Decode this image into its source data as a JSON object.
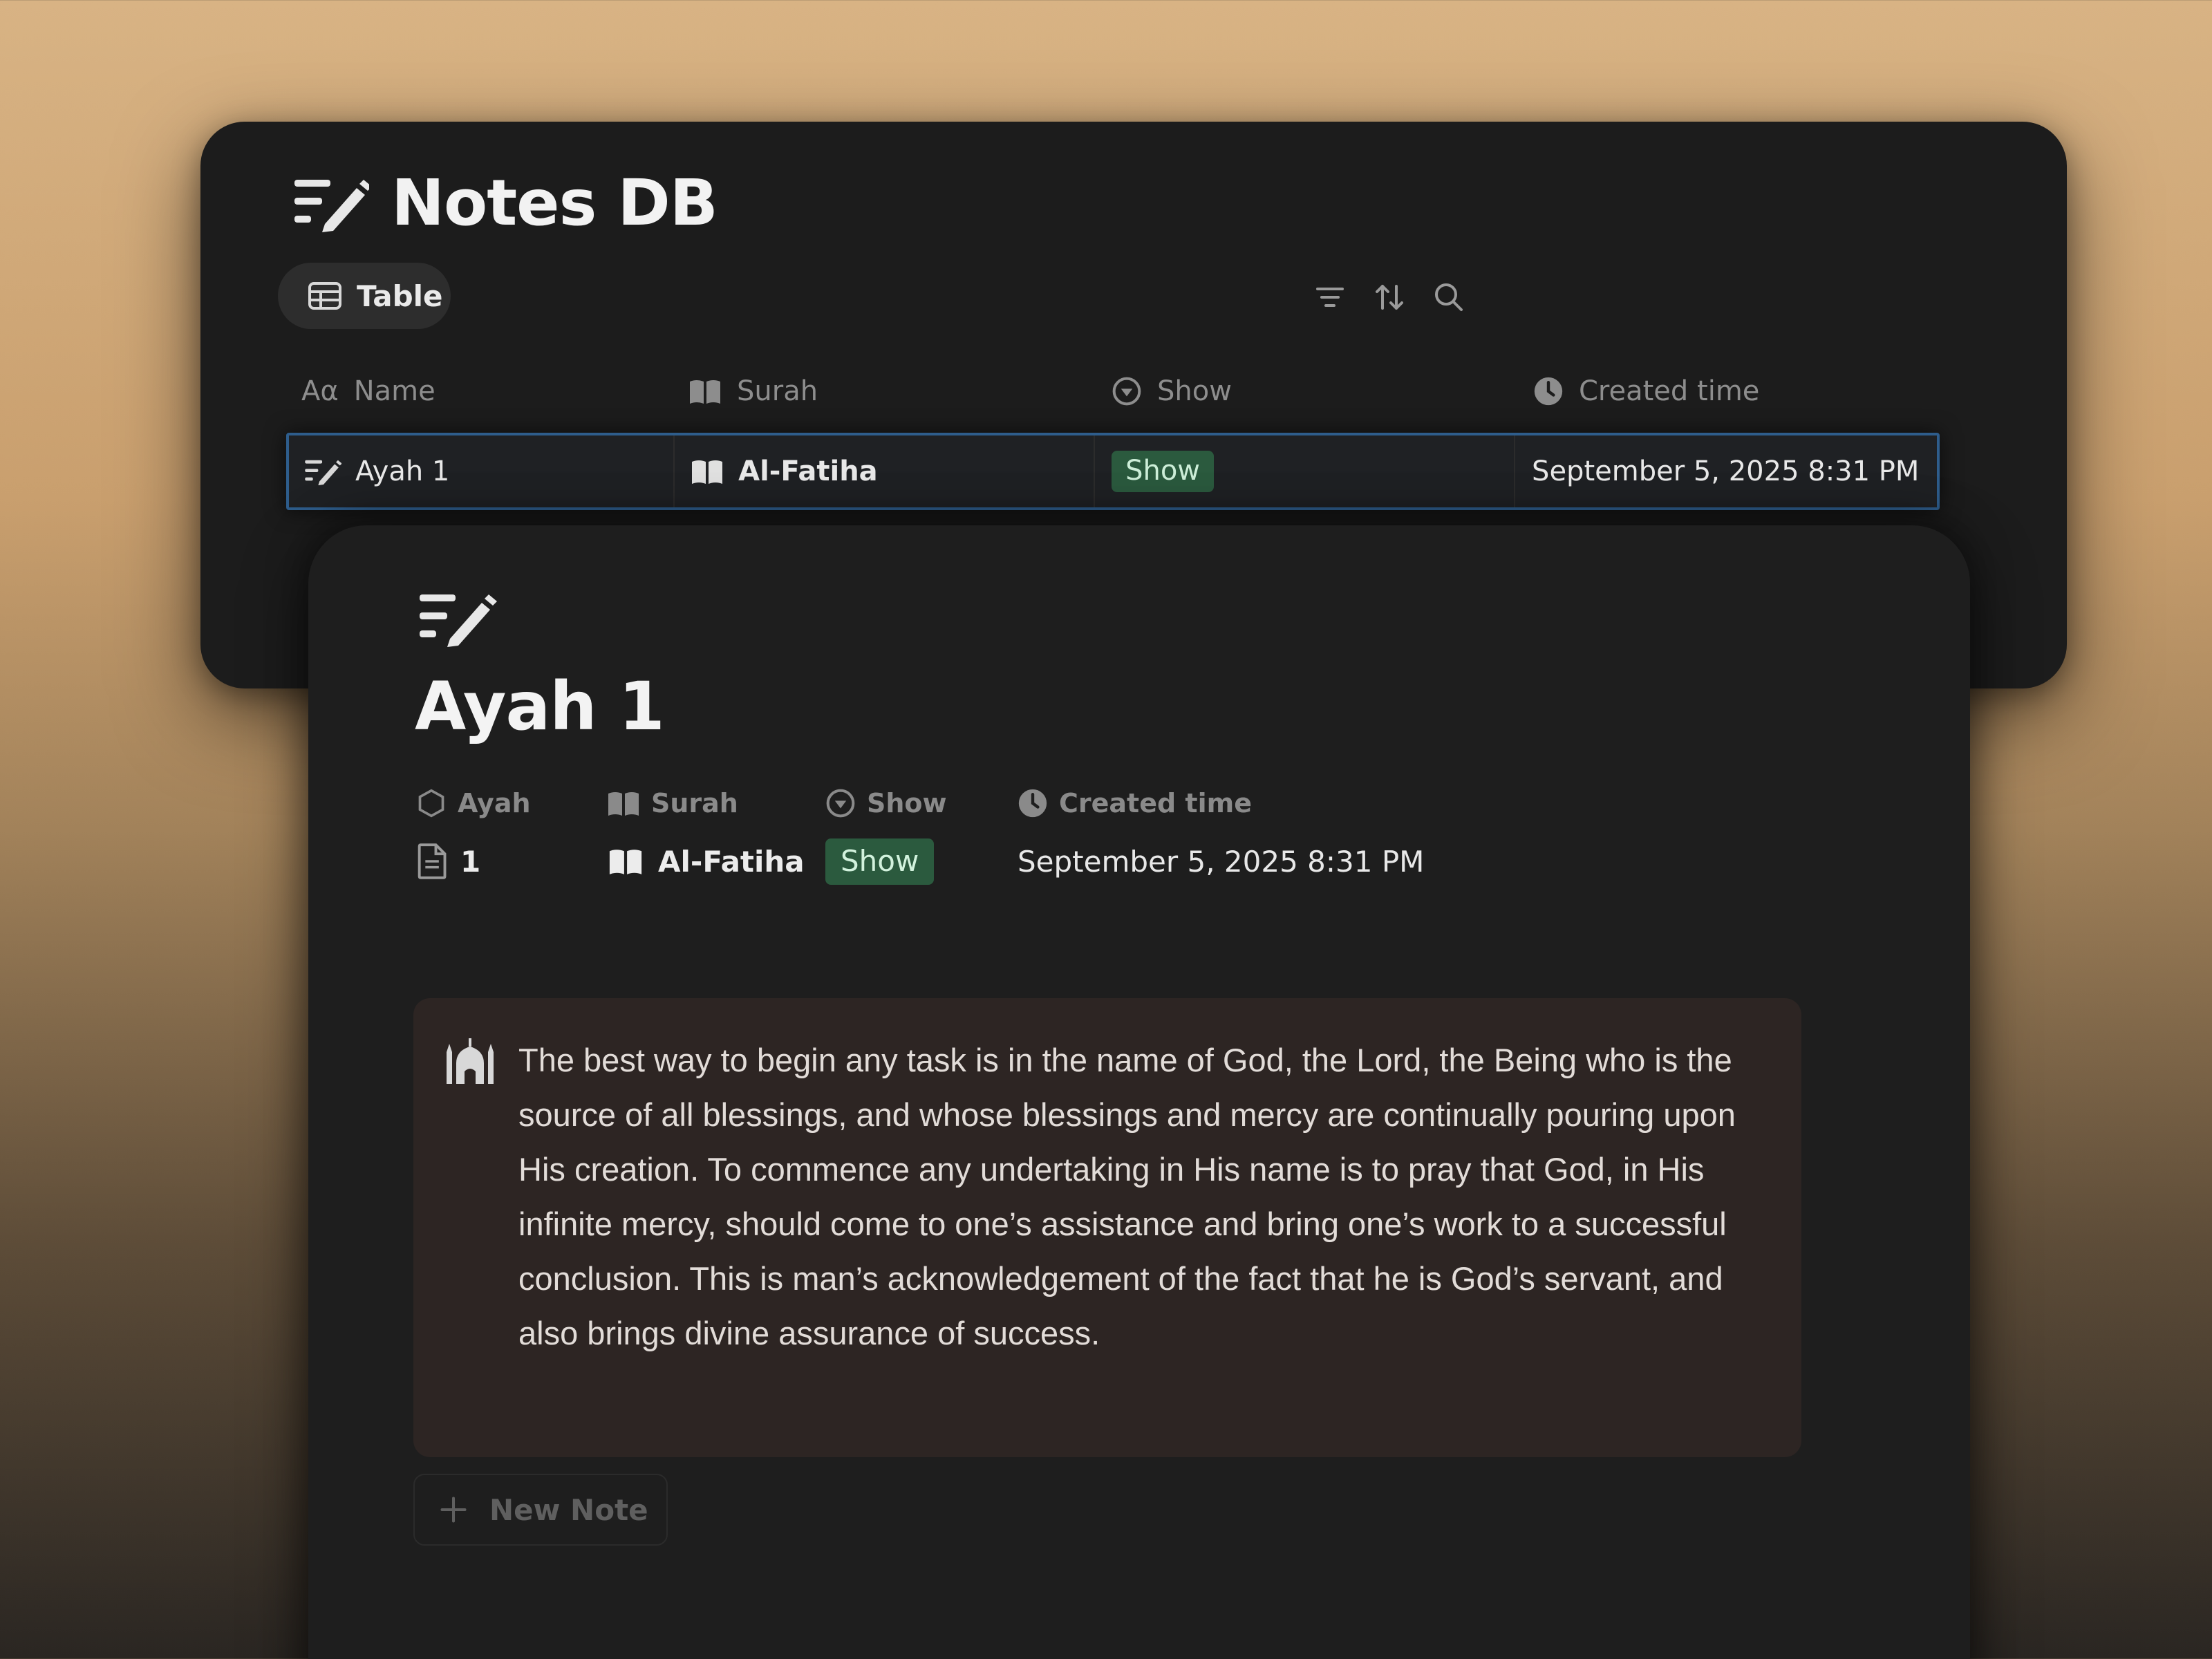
{
  "database": {
    "title": "Notes DB",
    "title_icon": "note-pencil-icon",
    "view_tab": {
      "label": "Table",
      "icon": "table-icon"
    },
    "toolbar": [
      {
        "name": "filter-icon"
      },
      {
        "name": "sort-icon"
      },
      {
        "name": "search-icon"
      }
    ],
    "columns": [
      {
        "label": "Name",
        "icon": "text-property-icon"
      },
      {
        "label": "Surah",
        "icon": "book-icon"
      },
      {
        "label": "Show",
        "icon": "status-icon"
      },
      {
        "label": "Created time",
        "icon": "clock-icon"
      }
    ],
    "rows": [
      {
        "name": "Ayah 1",
        "surah": "Al-Fatiha",
        "show": "Show",
        "created": "September 5, 2025 8:31 PM"
      }
    ]
  },
  "page": {
    "icon": "note-pencil-icon",
    "title": "Ayah 1",
    "properties": {
      "headers": [
        {
          "label": "Ayah",
          "icon": "hexagon-icon"
        },
        {
          "label": "Surah",
          "icon": "book-icon"
        },
        {
          "label": "Show",
          "icon": "status-icon"
        },
        {
          "label": "Created time",
          "icon": "clock-icon"
        }
      ],
      "values": {
        "ayah": "1",
        "surah": "Al-Fatiha",
        "show": "Show",
        "created": "September 5, 2025 8:31 PM"
      }
    },
    "callout": {
      "icon": "mosque-icon",
      "text": "The best way to begin any task is in the name of God, the Lord, the Being who is the source of all blessings, and whose blessings and mercy are continually pouring upon His creation. To commence any undertaking in His name is to pray that God, in His infinite mercy, should come to one’s assistance and bring one’s work to a successful conclusion. This is man’s acknowledgement of the fact that he is God’s servant, and also brings divine assurance of success."
    },
    "new_note_label": "New Note"
  },
  "colors": {
    "tag_green_bg": "#2b5a3e",
    "tag_green_text": "#cdeed8",
    "row_selected_border": "#2e5d8c",
    "callout_bg": "#2d2523"
  }
}
